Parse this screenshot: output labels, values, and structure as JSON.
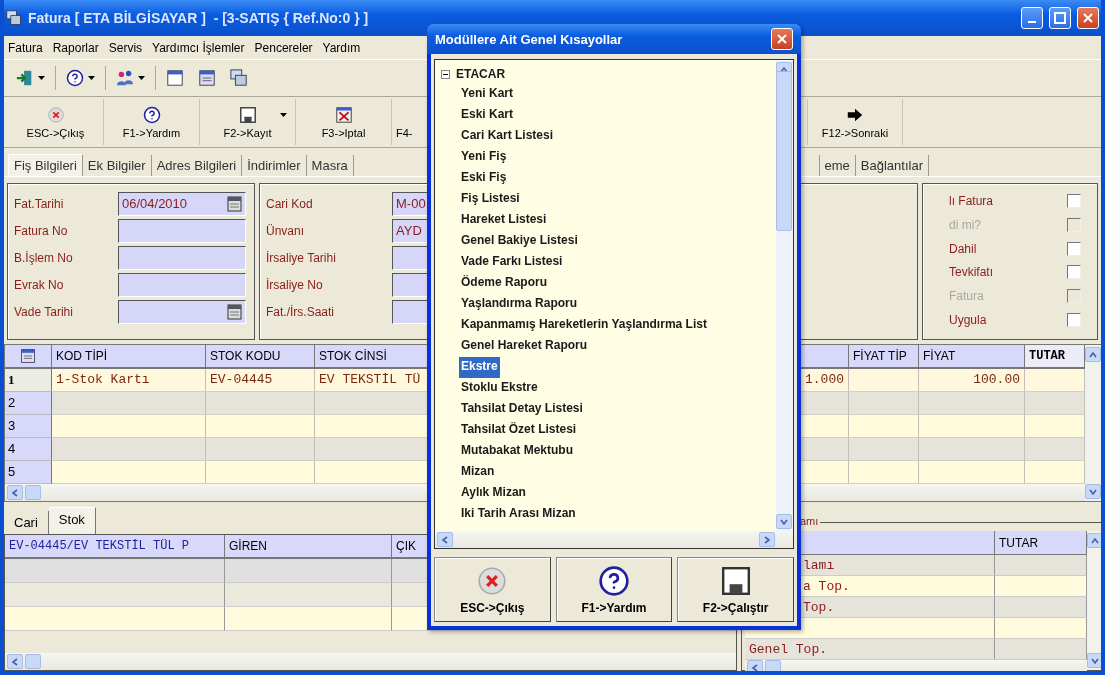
{
  "window": {
    "title": "Fatura [ ETA BİLGİSAYAR ]  - [3-SATIŞ { Ref.No:0 } ]"
  },
  "menu": [
    "Fatura",
    "Raporlar",
    "Servis",
    "Yardımcı İşlemler",
    "Pencereler",
    "Yardım"
  ],
  "quick_toolbar": [
    {
      "kind": "exit",
      "dropdown": true
    },
    {
      "kind": "help",
      "dropdown": true
    },
    {
      "kind": "users",
      "dropdown": true
    },
    {
      "kind": "window",
      "dropdown": false
    },
    {
      "kind": "form",
      "dropdown": false
    },
    {
      "kind": "windows",
      "dropdown": false
    }
  ],
  "toolbar": [
    {
      "kind": "cancel",
      "label": "ESC->Çıkış",
      "dropdown": false
    },
    {
      "kind": "help",
      "label": "F1->Yardım",
      "dropdown": false
    },
    {
      "kind": "save",
      "label": "F2->Kayıt",
      "dropdown": true
    },
    {
      "kind": "void",
      "label": "F3->Iptal",
      "dropdown": false
    },
    {
      "kind": "partial",
      "label": "F4-",
      "dropdown": false
    },
    {
      "kind": "next",
      "label": "F12->Sonraki",
      "dropdown": false
    }
  ],
  "tabs": [
    {
      "label": "Fiş Bilgileri",
      "selected": true
    },
    {
      "label": "Ek Bilgiler",
      "selected": false
    },
    {
      "label": "Adres Bilgileri",
      "selected": false
    },
    {
      "label": "İndirimler",
      "selected": false
    },
    {
      "label": "Masra",
      "selected": false
    },
    {
      "label": "eme",
      "selected": false
    },
    {
      "label": "Bağlantılar",
      "selected": false
    }
  ],
  "form": {
    "left": [
      {
        "label": "Fat.Tarihi",
        "value": "06/04/2010",
        "calendar": true
      },
      {
        "label": "Fatura No",
        "calendar": false
      },
      {
        "label": "B.İşlem No",
        "calendar": false
      },
      {
        "label": "Evrak No",
        "calendar": false
      },
      {
        "label": "Vade Tarihi",
        "calendar": true
      }
    ],
    "middle": [
      {
        "label": "Cari Kod",
        "value": "M-00"
      },
      {
        "label": "Ünvanı",
        "value": "AYD"
      },
      {
        "label": "İrsaliye Tarihi"
      },
      {
        "label": "İrsaliye No"
      },
      {
        "label": "Fat./İrs.Saati"
      }
    ],
    "options": [
      {
        "label": "lı Fatura",
        "checked": false,
        "disabled": false
      },
      {
        "label": "di mi?",
        "checked": false,
        "disabled": true
      },
      {
        "label": "Dahil",
        "checked": false,
        "disabled": false
      },
      {
        "label": "Tevkifatı",
        "checked": false,
        "disabled": false
      },
      {
        "label": "Fatura",
        "checked": false,
        "disabled": true
      },
      {
        "label": "Uygula",
        "checked": false,
        "disabled": false
      }
    ]
  },
  "grid": {
    "columns": [
      {
        "label": "KOD TİPİ",
        "current": false
      },
      {
        "label": "STOK KODU",
        "current": false
      },
      {
        "label": "STOK CİNSİ",
        "current": false
      },
      {
        "current": false
      },
      {
        "label": "FİYAT TİP",
        "current": false
      },
      {
        "label": "FİYAT",
        "current": false
      },
      {
        "label": "TUTAR",
        "current": true
      }
    ],
    "rows": [
      {
        "number": "1",
        "current": true,
        "cells": [
          "1-Stok Kartı",
          "EV-04445",
          "EV TEKSTİL TÜ",
          "1.000",
          null,
          "100.00",
          null
        ]
      },
      {
        "number": "2",
        "current": false
      },
      {
        "number": "3",
        "current": false
      },
      {
        "number": "4",
        "current": false
      },
      {
        "number": "5",
        "current": false
      }
    ]
  },
  "bottom_tabs": [
    {
      "label": "Cari",
      "selected": false
    },
    {
      "label": "Stok",
      "selected": true
    }
  ],
  "stock_grid": {
    "columns": [
      "EV-04445/EV TEKSTİL TÜL P",
      "GİREN",
      "ÇIK"
    ]
  },
  "totals": {
    "title": "amı",
    "columns": [
      {},
      {
        "label": "TUTAR"
      }
    ],
    "rows": [
      {
        "label": "lamı"
      },
      {
        "label": "a Top."
      },
      {
        "label": "Top."
      },
      {},
      {
        "label": "Genel Top."
      }
    ]
  },
  "dialog": {
    "title": "Modüllere Ait Genel Kısayollar",
    "tree": [
      {
        "label": "ETACAR",
        "expanded": true,
        "children": [
          {
            "label": "Yeni Kart",
            "selected": false
          },
          {
            "label": "Eski Kart",
            "selected": false
          },
          {
            "label": "Cari Kart Listesi",
            "selected": false
          },
          {
            "label": "Yeni Fiş",
            "selected": false
          },
          {
            "label": "Eski Fiş",
            "selected": false
          },
          {
            "label": "Fiş Listesi",
            "selected": false
          },
          {
            "label": "Hareket Listesi",
            "selected": false
          },
          {
            "label": "Genel Bakiye Listesi",
            "selected": false
          },
          {
            "label": "Vade Farkı Listesi",
            "selected": false
          },
          {
            "label": "Ödeme Raporu",
            "selected": false
          },
          {
            "label": "Yaşlandırma Raporu",
            "selected": false
          },
          {
            "label": "Kapanmamış Hareketlerin Yaşlandırma List",
            "selected": false
          },
          {
            "label": "Genel Hareket Raporu",
            "selected": false
          },
          {
            "label": "Ekstre",
            "selected": true
          },
          {
            "label": "Stoklu Ekstre",
            "selected": false
          },
          {
            "label": "Tahsilat Detay Listesi",
            "selected": false
          },
          {
            "label": "Tahsilat Özet Listesi",
            "selected": false
          },
          {
            "label": "Mutabakat Mektubu",
            "selected": false
          },
          {
            "label": "Mizan",
            "selected": false
          },
          {
            "label": "Aylık Mizan",
            "selected": false
          },
          {
            "label": "Iki Tarih Arası Mizan",
            "selected": false
          }
        ]
      }
    ],
    "buttons": [
      {
        "kind": "cancel",
        "label": "ESC->Çıkış"
      },
      {
        "kind": "help",
        "label": "F1->Yardım"
      },
      {
        "kind": "save",
        "label": "F2->Çalıştır"
      }
    ]
  }
}
